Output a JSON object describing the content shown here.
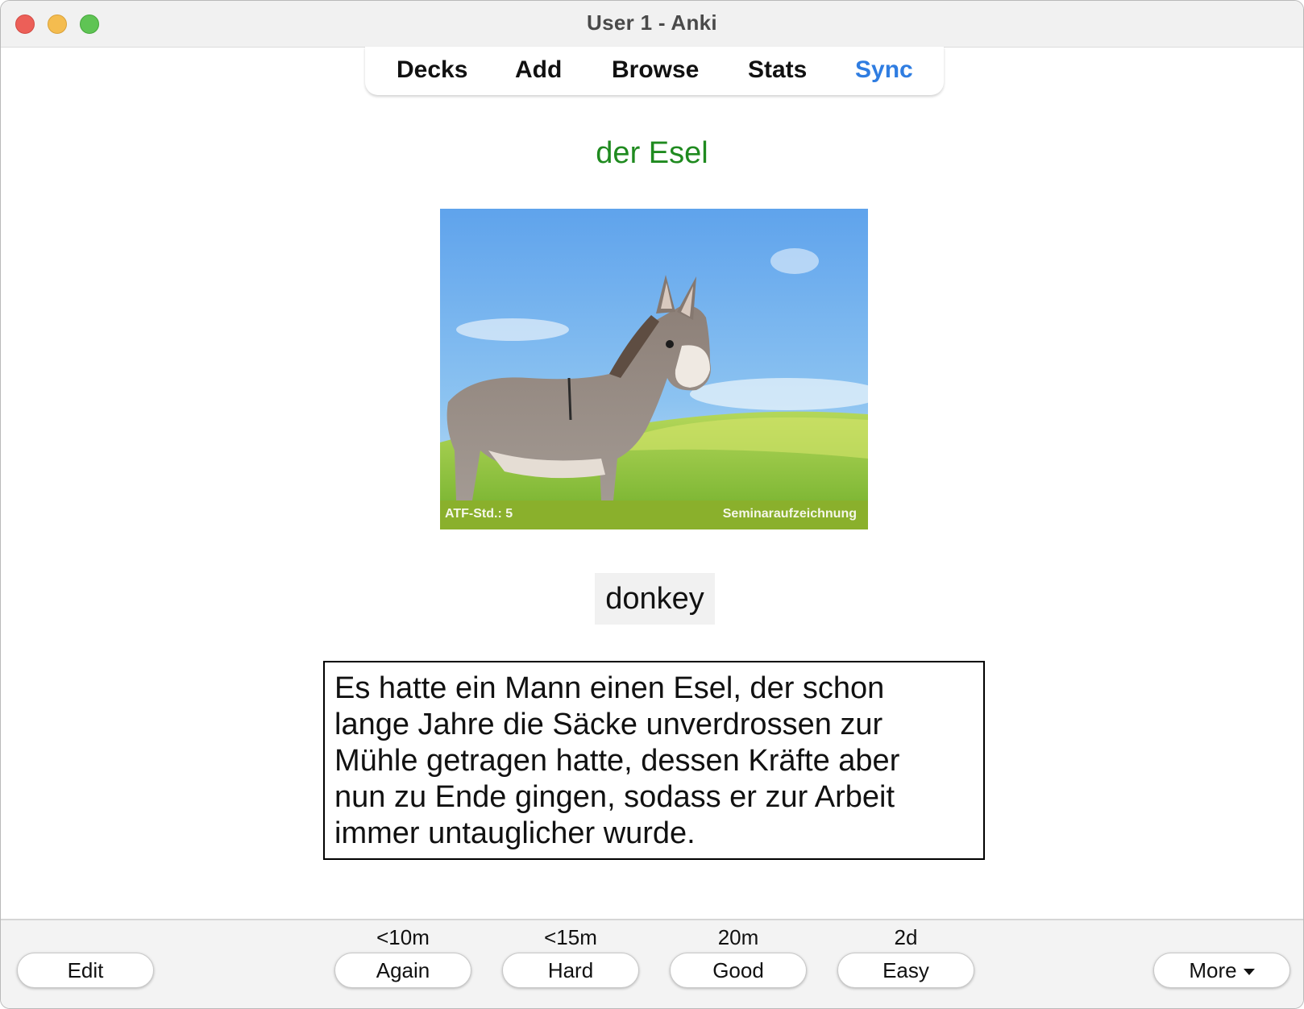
{
  "window": {
    "title": "User 1 - Anki"
  },
  "nav": {
    "decks": "Decks",
    "add": "Add",
    "browse": "Browse",
    "stats": "Stats",
    "sync": "Sync"
  },
  "card": {
    "front": "der Esel",
    "image": {
      "subject": "donkey photo",
      "banner_left": "ATF-Std.: 5",
      "banner_right": "Seminaraufzeichnung"
    },
    "answer": "donkey",
    "example_lines": [
      "Es hatte ein Mann einen Esel, der schon",
      "lange Jahre die Säcke unverdrossen zur",
      "Mühle getragen hatte, dessen Kräfte aber",
      "nun zu Ende gingen, sodass er zur Arbeit",
      "immer untauglicher wurde."
    ]
  },
  "bottom": {
    "edit": "Edit",
    "more": "More",
    "answers": [
      {
        "interval": "<10m",
        "label": "Again"
      },
      {
        "interval": "<15m",
        "label": "Hard"
      },
      {
        "interval": "20m",
        "label": "Good"
      },
      {
        "interval": "2d",
        "label": "Easy"
      }
    ]
  },
  "colors": {
    "front_text": "#1f8a1f",
    "sync_link": "#2f7de1",
    "image_banner": "#8ab02c"
  }
}
